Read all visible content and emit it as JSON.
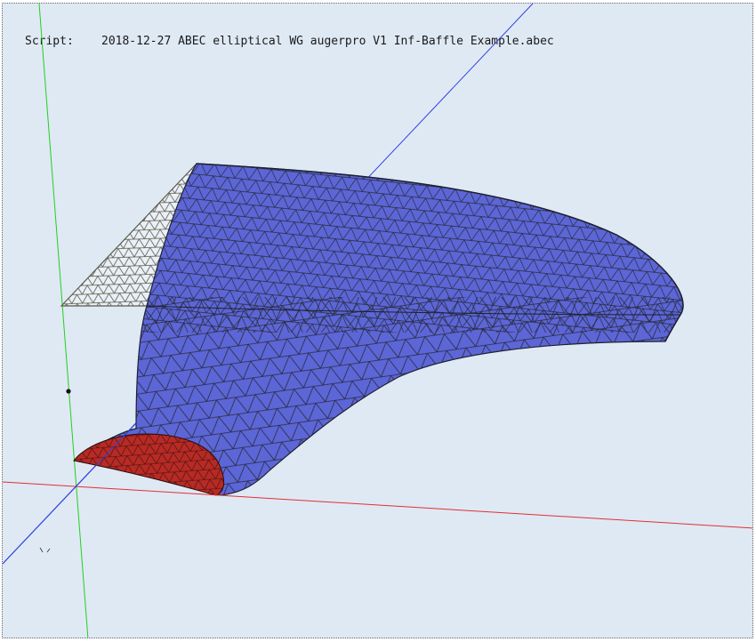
{
  "script": {
    "label": "Script:",
    "filename": "2018-12-27 ABEC elliptical WG augerpro V1 Inf-Baffle Example.abec"
  },
  "colors": {
    "background": "#dfe9f4",
    "waveguide_mesh_fill": "#5c66d6",
    "driver_face_fill": "#b82a24",
    "baffle_wireframe_stroke": "#5a5a48",
    "mesh_edge": "#2a2a3a",
    "axis_x": "#e03030",
    "axis_y": "#20d020",
    "axis_z": "#3040e0"
  },
  "icons": {
    "origin_marker": "origin-dot-icon",
    "orientation_glyph": "orientation-glyph-icon"
  }
}
